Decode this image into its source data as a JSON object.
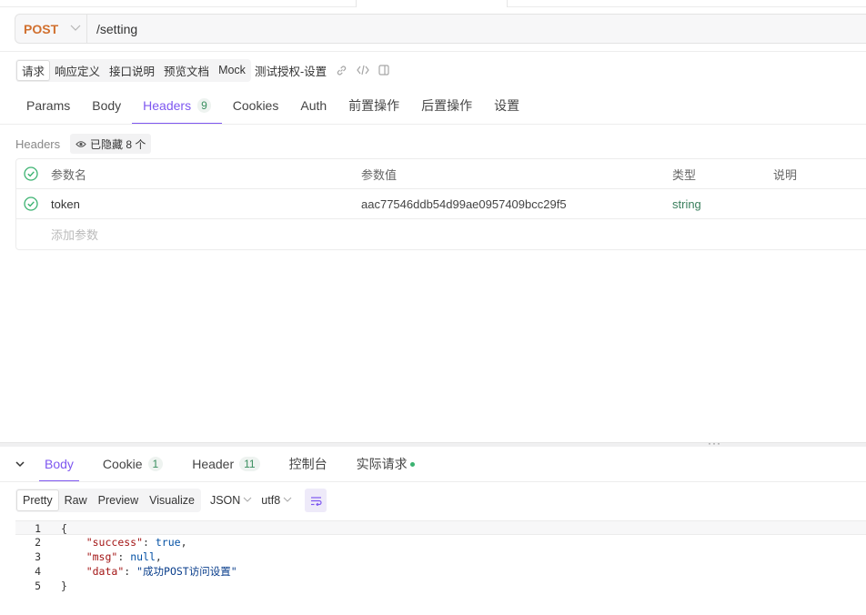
{
  "request": {
    "method": "POST",
    "url": "/setting"
  },
  "sub_toolbar": {
    "items": [
      "请求",
      "响应定义",
      "接口说明",
      "预览文档",
      "Mock"
    ],
    "api_name": "测试授权-设置"
  },
  "request_tabs": [
    {
      "label": "Params",
      "count": ""
    },
    {
      "label": "Body",
      "count": ""
    },
    {
      "label": "Headers",
      "count": "9"
    },
    {
      "label": "Cookies",
      "count": ""
    },
    {
      "label": "Auth",
      "count": ""
    },
    {
      "label": "前置操作",
      "count": ""
    },
    {
      "label": "后置操作",
      "count": ""
    },
    {
      "label": "设置",
      "count": ""
    }
  ],
  "headers_section": {
    "label": "Headers",
    "hidden_badge": "已隐藏 8 个"
  },
  "param_table": {
    "columns": [
      "参数名",
      "参数值",
      "类型",
      "说明"
    ],
    "rows": [
      {
        "name": "token",
        "value": "aac77546ddb54d99ae0957409bcc29f5",
        "type": "string",
        "desc": ""
      }
    ],
    "add_placeholder": "添加参数"
  },
  "response_tabs": [
    {
      "label": "Body",
      "count": ""
    },
    {
      "label": "Cookie",
      "count": "1"
    },
    {
      "label": "Header",
      "count": "11"
    },
    {
      "label": "控制台",
      "count": ""
    },
    {
      "label": "实际请求",
      "count": ""
    }
  ],
  "format_bar": {
    "modes": [
      "Pretty",
      "Raw",
      "Preview",
      "Visualize"
    ],
    "language": "JSON",
    "encoding": "utf8"
  },
  "code_lines": [
    {
      "num": "1",
      "text": "{"
    },
    {
      "num": "2",
      "key": "\"success\"",
      "val": "true",
      "tail": ","
    },
    {
      "num": "3",
      "key": "\"msg\"",
      "val": "null",
      "tail": ","
    },
    {
      "num": "4",
      "key": "\"data\"",
      "val": "\"成功POST访问设置\"",
      "tail": ""
    },
    {
      "num": "5",
      "text": "}"
    }
  ],
  "colors": {
    "accent": "#7e57f0",
    "method": "#d1702f",
    "success": "#3cb371"
  }
}
